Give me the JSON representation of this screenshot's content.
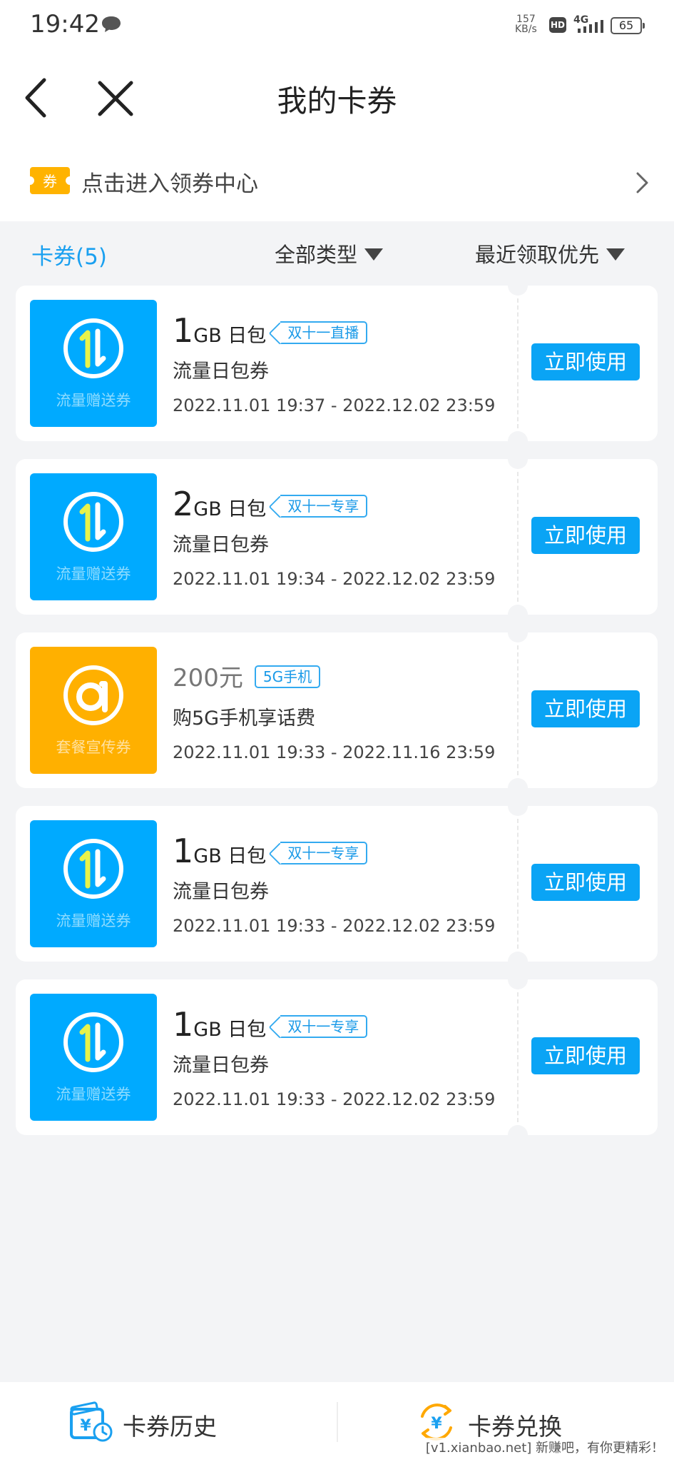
{
  "status_bar": {
    "time": "19:42",
    "speed_value": "157",
    "speed_unit": "KB/s",
    "hd": "HD",
    "network": "4G",
    "battery": "65"
  },
  "header": {
    "title": "我的卡券"
  },
  "coupon_center": {
    "badge_text": "券",
    "label": "点击进入领券中心"
  },
  "filters": {
    "tab": "卡券(5)",
    "type": "全部类型",
    "sort": "最近领取优先"
  },
  "coupons": [
    {
      "kind": "流量赠送券",
      "amount": "1",
      "unit": "GB 日包",
      "tag": "双十一直播",
      "name": "流量日包券",
      "validity": "2022.11.01 19:37 - 2022.12.02 23:59",
      "action": "立即使用",
      "color": "#00aaff"
    },
    {
      "kind": "流量赠送券",
      "amount": "2",
      "unit": "GB 日包",
      "tag": "双十一专享",
      "name": "流量日包券",
      "validity": "2022.11.01 19:34 - 2022.12.02 23:59",
      "action": "立即使用",
      "color": "#00aaff"
    },
    {
      "kind": "套餐宣传券",
      "amount": "200元",
      "tag": "5G手机",
      "name": "购5G手机享话费",
      "validity": "2022.11.01 19:33 - 2022.11.16 23:59",
      "action": "立即使用",
      "color": "#ffb000"
    },
    {
      "kind": "流量赠送券",
      "amount": "1",
      "unit": "GB 日包",
      "tag": "双十一专享",
      "name": "流量日包券",
      "validity": "2022.11.01 19:33 - 2022.12.02 23:59",
      "action": "立即使用",
      "color": "#00aaff"
    },
    {
      "kind": "流量赠送券",
      "amount": "1",
      "unit": "GB 日包",
      "tag": "双十一专享",
      "name": "流量日包券",
      "validity": "2022.11.01 19:33 - 2022.12.02 23:59",
      "action": "立即使用",
      "color": "#00aaff"
    }
  ],
  "bottom_bar": {
    "history": "卡券历史",
    "exchange": "卡券兑换",
    "history_symbol": "¥",
    "exchange_symbol": "¥"
  },
  "watermark": "[v1.xianbao.net] 新赚吧，有你更精彩！",
  "colors": {
    "accent": "#0aa4f5",
    "flow_thumb": "#00aaff",
    "plan_thumb": "#ffb000",
    "ticket_yellow": "#ffb300"
  }
}
